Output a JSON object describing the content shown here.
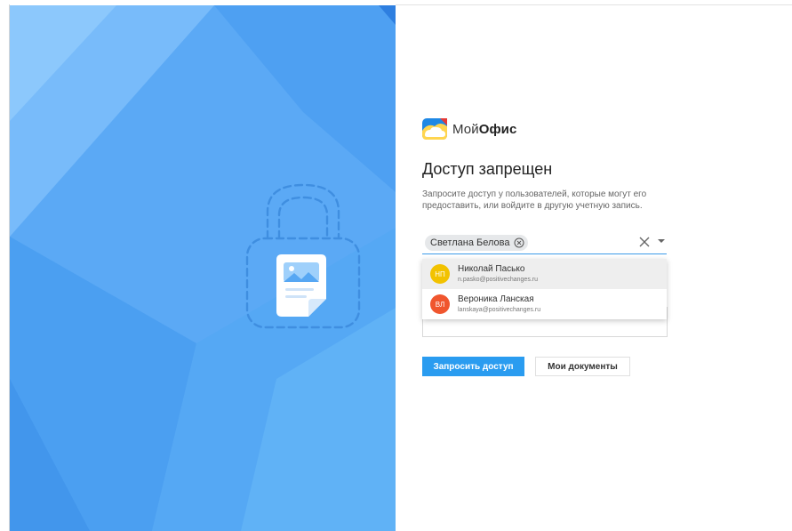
{
  "brand": {
    "name_light": "Мой",
    "name_bold": "Офис"
  },
  "page": {
    "title": "Доступ запрещен",
    "description": "Запросите доступ у пользователей, которые могут его предоставить, или войдите в другую учетную запись."
  },
  "recipient_field": {
    "chips": [
      {
        "label": "Светлана Белова"
      }
    ],
    "clear_icon": "close-icon",
    "dropdown_icon": "caret-down-icon"
  },
  "suggestions": [
    {
      "initials": "НП",
      "name": "Николай Пасько",
      "email": "n.pasko@positivechanges.ru",
      "color": "#f2c200",
      "highlighted": true
    },
    {
      "initials": "ВЛ",
      "name": "Вероника Ланская",
      "email": "lanskaya@positivechanges.ru",
      "color": "#f0562e",
      "highlighted": false
    }
  ],
  "buttons": {
    "request": "Запросить доступ",
    "my_docs": "Мои документы"
  },
  "colors": {
    "accent": "#2a9cf0",
    "hero_base": "#5aa8f5",
    "field_underline": "#3d9be9"
  },
  "illustration": {
    "icon": "lock-document-icon"
  }
}
